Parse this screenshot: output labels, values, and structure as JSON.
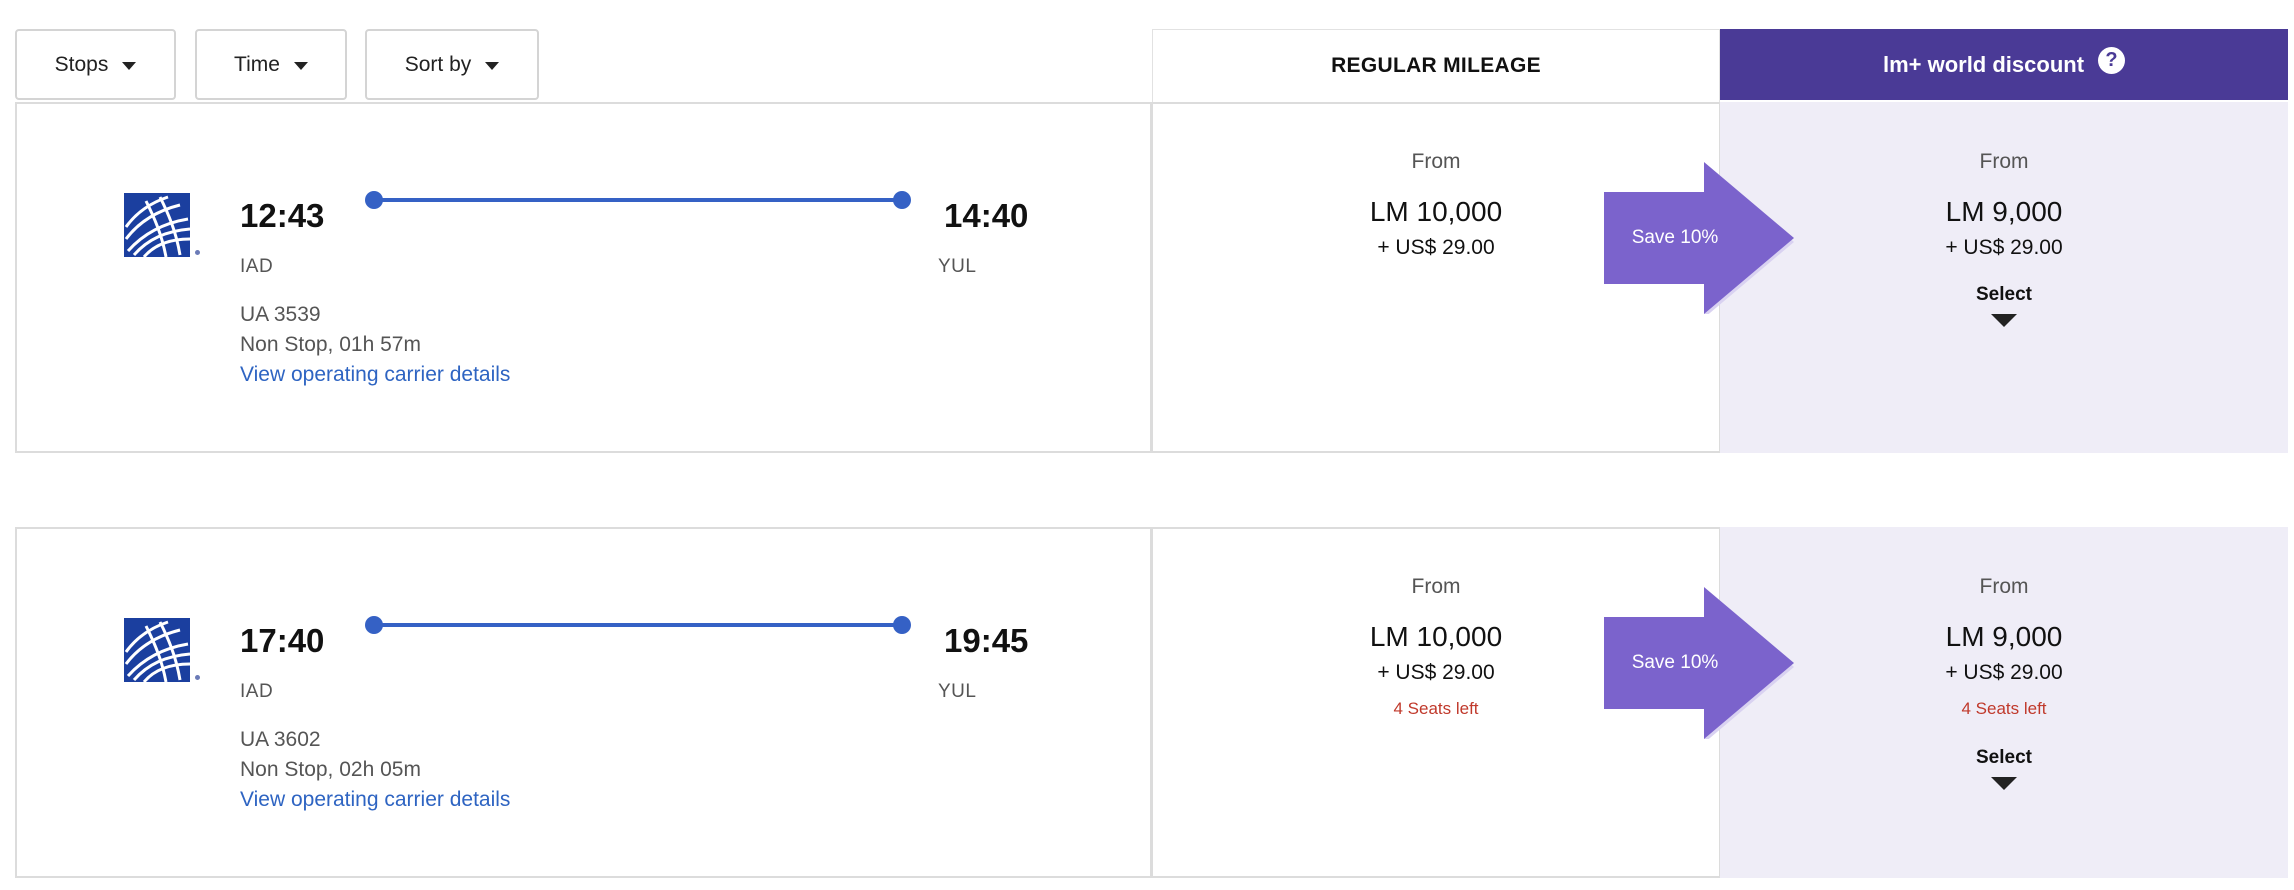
{
  "filters": {
    "stops_label": "Stops",
    "time_label": "Time",
    "sort_label": "Sort by"
  },
  "headers": {
    "regular": "REGULAR MILEAGE",
    "discount": "lm+ world discount",
    "help_icon": "?"
  },
  "flights": [
    {
      "depart_time": "12:43",
      "arrive_time": "14:40",
      "origin": "IAD",
      "destination": "YUL",
      "flight_number": "UA 3539",
      "duration": "Non Stop, 01h 57m",
      "carrier_link": "View operating carrier details",
      "regular": {
        "from": "From",
        "miles": "LM 10,000",
        "usd": "+ US$ 29.00",
        "seats": ""
      },
      "save": "Save 10%",
      "discount": {
        "from": "From",
        "miles": "LM 9,000",
        "usd": "+ US$ 29.00",
        "seats": "",
        "select": "Select"
      }
    },
    {
      "depart_time": "17:40",
      "arrive_time": "19:45",
      "origin": "IAD",
      "destination": "YUL",
      "flight_number": "UA 3602",
      "duration": "Non Stop, 02h 05m",
      "carrier_link": "View operating carrier details",
      "regular": {
        "from": "From",
        "miles": "LM 10,000",
        "usd": "+ US$ 29.00",
        "seats": "4 Seats left"
      },
      "save": "Save 10%",
      "discount": {
        "from": "From",
        "miles": "LM 9,000",
        "usd": "+ US$ 29.00",
        "seats": "4 Seats left",
        "select": "Select"
      }
    }
  ],
  "colors": {
    "discount_header": "#4a3a96",
    "discount_bg": "#efedf7",
    "save_arrow": "#7b63cc",
    "route": "#3561c5",
    "link": "#2e64c2",
    "seats_warning": "#c0392b",
    "logo": "#1b3f9f"
  },
  "icons": {
    "filter_caret": "caret-down-icon",
    "select_caret": "triangle-down-icon",
    "airline_logo": "united-globe-icon",
    "help": "question-circle-icon"
  }
}
